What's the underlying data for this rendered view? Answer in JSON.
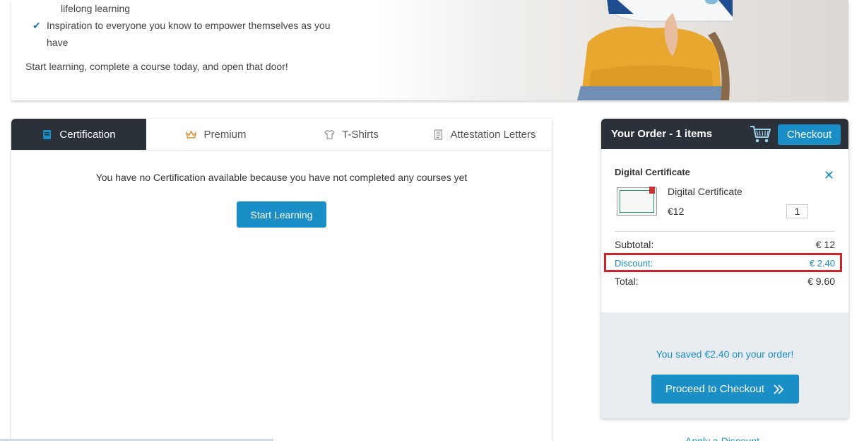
{
  "hero": {
    "bullet_partial": "lifelong learning",
    "bullet_line1": "Inspiration to everyone you know to empower themselves as you",
    "bullet_line2": "have",
    "closing": "Start learning, complete a course today, and open that door!"
  },
  "tabs": [
    {
      "label": "Certification",
      "icon": "certificate-icon",
      "active": true
    },
    {
      "label": "Premium",
      "icon": "crown-icon",
      "active": false
    },
    {
      "label": "T-Shirts",
      "icon": "tshirt-icon",
      "active": false
    },
    {
      "label": "Attestation Letters",
      "icon": "document-icon",
      "active": false
    }
  ],
  "certification": {
    "empty_message": "You have no Certification available because you have not completed any courses yet",
    "start_button": "Start Learning"
  },
  "order": {
    "title": "Your Order -  1 items",
    "checkout_button": "Checkout",
    "item_heading": "Digital Certificate",
    "item_name": "Digital Certificate",
    "item_price": "€12",
    "quantity": "1",
    "subtotal_label": "Subtotal:",
    "subtotal_value": "€ 12",
    "discount_label": "Discount:",
    "discount_value": "€ 2.40",
    "total_label": "Total:",
    "total_value": "€ 9.60",
    "saved_message": "You saved €2.40 on your order!",
    "proceed_button": "Proceed to Checkout",
    "apply_discount": "Apply a Discount"
  },
  "colors": {
    "accent": "#1a8ec6",
    "dark_header": "#2a3138",
    "highlight": "#d0232a",
    "footer_bg": "#e9edf1"
  }
}
